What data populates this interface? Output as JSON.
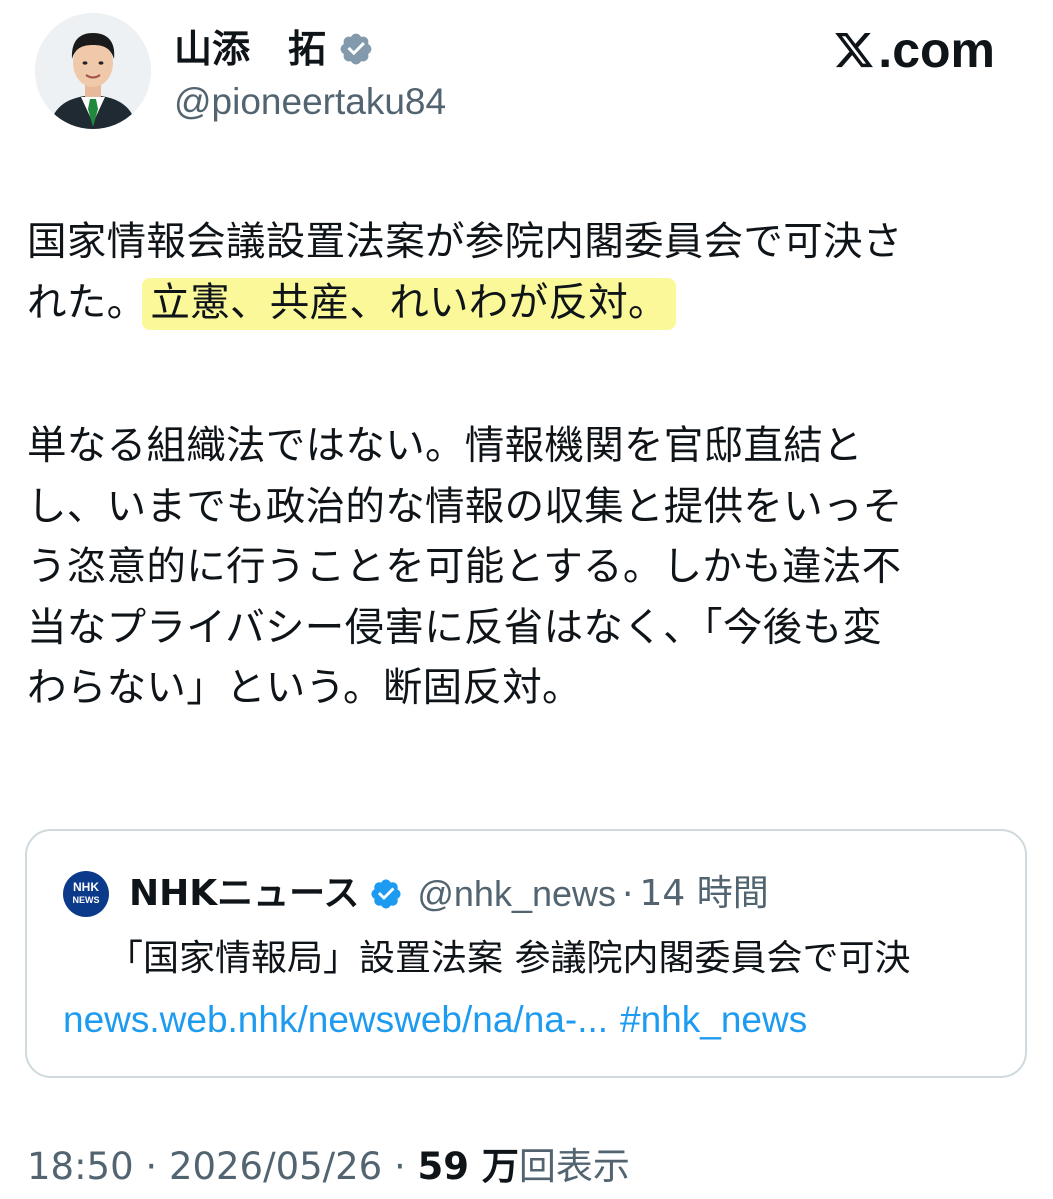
{
  "brand": {
    "label": ".com",
    "icon": "x-logo-icon"
  },
  "author": {
    "name": "山添　拓",
    "handle": "@pioneertaku84",
    "verified": true,
    "avatar": "avatar"
  },
  "tweet": {
    "para1_text": "国家情報会議設置法案が参院内閣委員会で可決さ\nれた。",
    "para1_highlight": "立憲、共産、れいわが反対。",
    "para2_text": "単なる組織法ではない。情報機関を官邸直結と\nし、いまでも政治的な情報の収集と提供をいっそ\nう恣意的に行うことを可能とする。しかも違法不\n当なプライバシー侵害に反省はなく、「今後も変\nわらない」という。断固反対。",
    "highlight_color": "#fbf89a"
  },
  "quote": {
    "logo_line1": "NHK",
    "logo_line2": "NEWS",
    "name": "NHKニュース",
    "handle": "@nhk_news",
    "time": "14 時間",
    "text": "「国家情報局」設置法案 参議院内閣委員会で可決",
    "link": "news.web.nhk/newsweb/na/na-...",
    "hashtag": "#nhk_news",
    "link_color": "#1d9bf0"
  },
  "meta": {
    "time": "18:50",
    "date": "2026/05/26",
    "views_count": "59 万",
    "views_label": "回表示",
    "separator": "·"
  }
}
